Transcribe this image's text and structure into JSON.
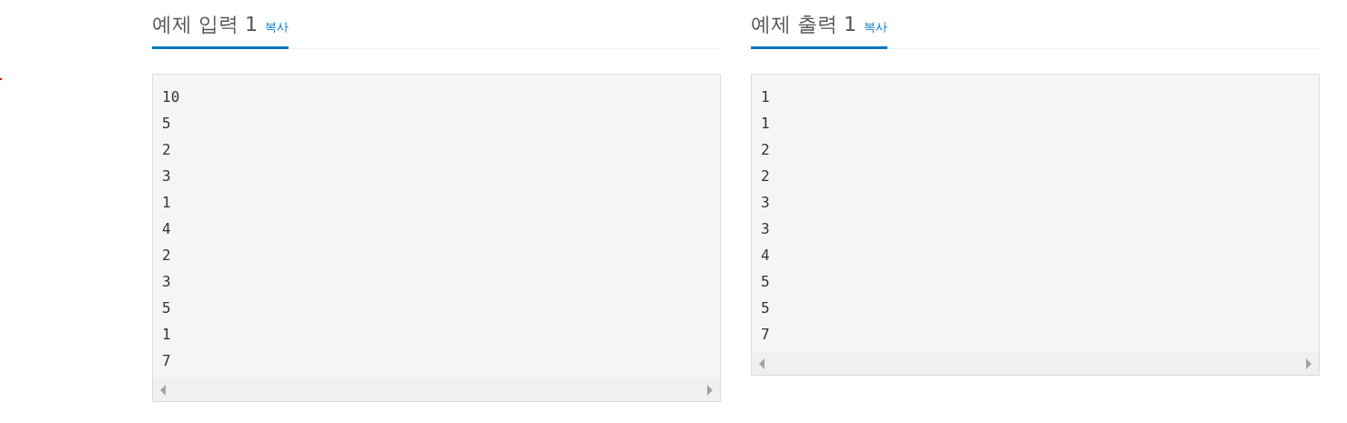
{
  "samples": [
    {
      "title": "예제 입력 1",
      "copy_link": "복사",
      "lines": [
        "10",
        "5",
        "2",
        "3",
        "1",
        "4",
        "2",
        "3",
        "5",
        "1",
        "7"
      ]
    },
    {
      "title": "예제 출력 1",
      "copy_link": "복사",
      "lines": [
        "1",
        "1",
        "2",
        "2",
        "3",
        "3",
        "4",
        "5",
        "5",
        "7"
      ]
    }
  ]
}
